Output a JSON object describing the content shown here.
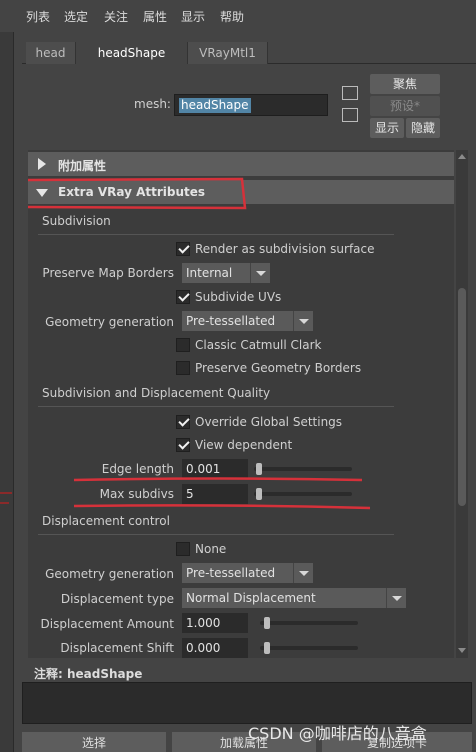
{
  "menu": [
    "列表",
    "选定",
    "关注",
    "属性",
    "显示",
    "帮助"
  ],
  "tabs": [
    {
      "label": "head",
      "active": false
    },
    {
      "label": "headShape",
      "active": true
    },
    {
      "label": "VRayMtl1",
      "active": false
    }
  ],
  "mesh": {
    "label": "mesh:",
    "value": "headShape"
  },
  "side_buttons": {
    "focus": "聚焦",
    "presets": "预设*",
    "show": "显示",
    "hide": "隐藏"
  },
  "panel": {
    "extra_attributes": "附加属性",
    "vray_attributes": "Extra VRay Attributes",
    "subdivision": {
      "title": "Subdivision",
      "render_as_subdiv": {
        "label": "Render as subdivision surface",
        "checked": true
      },
      "preserve_map_borders": {
        "label": "Preserve Map Borders",
        "value": "Internal"
      },
      "subdivide_uvs": {
        "label": "Subdivide UVs",
        "checked": true
      },
      "geometry_generation": {
        "label": "Geometry generation",
        "value": "Pre-tessellated"
      },
      "classic_catmull": {
        "label": "Classic Catmull Clark",
        "checked": false
      },
      "preserve_geometry_borders": {
        "label": "Preserve Geometry Borders",
        "checked": false
      }
    },
    "quality": {
      "title": "Subdivision and Displacement Quality",
      "override_global": {
        "label": "Override Global Settings",
        "checked": true
      },
      "view_dependent": {
        "label": "View dependent",
        "checked": true
      },
      "edge_length": {
        "label": "Edge length",
        "value": "0.001",
        "slider": 0.05
      },
      "max_subdivs": {
        "label": "Max subdivs",
        "value": "5",
        "slider": 0.05
      }
    },
    "displacement": {
      "title": "Displacement control",
      "none": {
        "label": "None",
        "checked": false
      },
      "geometry_generation": {
        "label": "Geometry generation",
        "value": "Pre-tessellated"
      },
      "displacement_type": {
        "label": "Displacement type",
        "value": "Normal Displacement"
      },
      "displacement_amount": {
        "label": "Displacement Amount",
        "value": "1.000",
        "slider": 0.1
      },
      "displacement_shift": {
        "label": "Displacement Shift",
        "value": "0.000",
        "slider": 0.1
      }
    }
  },
  "notes": {
    "label": "注释:",
    "shape": "headShape"
  },
  "bottom_buttons": [
    "选择",
    "加载属性",
    "复制选项卡"
  ],
  "watermark": "CSDN @咖啡店的八音盒",
  "colors": {
    "highlight_red": "#d6313a",
    "selection": "#5285a6",
    "panel_bg": "#3c3c3c"
  }
}
